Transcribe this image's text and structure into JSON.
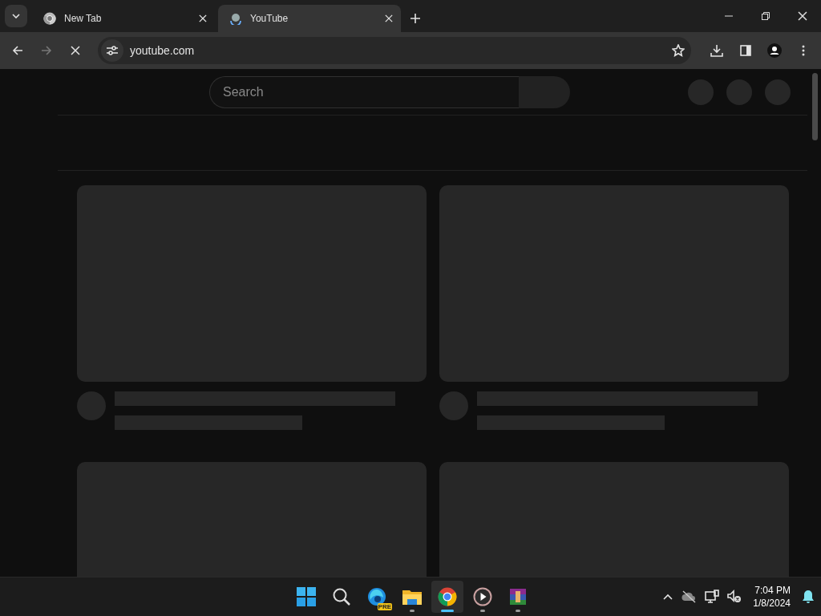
{
  "tabs": [
    {
      "title": "New Tab",
      "selected": false,
      "kind": "chrome"
    },
    {
      "title": "YouTube",
      "selected": true,
      "kind": "loading"
    }
  ],
  "address_bar": {
    "url": "youtube.com",
    "loading": true
  },
  "page": {
    "search": {
      "placeholder": "Search"
    },
    "cards": [
      {
        "kind": "skeleton"
      },
      {
        "kind": "skeleton"
      },
      {
        "kind": "thumbnail"
      },
      {
        "kind": "thumbnail"
      }
    ]
  },
  "taskbar": {
    "apps": [
      {
        "kind": "start",
        "running": false,
        "selected": false
      },
      {
        "kind": "search",
        "running": false,
        "selected": false
      },
      {
        "kind": "edge",
        "running": false,
        "selected": false,
        "badge": "PRE"
      },
      {
        "kind": "files",
        "running": true,
        "selected": false
      },
      {
        "kind": "chrome",
        "running": true,
        "selected": true
      },
      {
        "kind": "media",
        "running": true,
        "selected": false
      },
      {
        "kind": "winrar",
        "running": true,
        "selected": false
      }
    ],
    "time": "7:04 PM",
    "date": "1/8/2024"
  }
}
